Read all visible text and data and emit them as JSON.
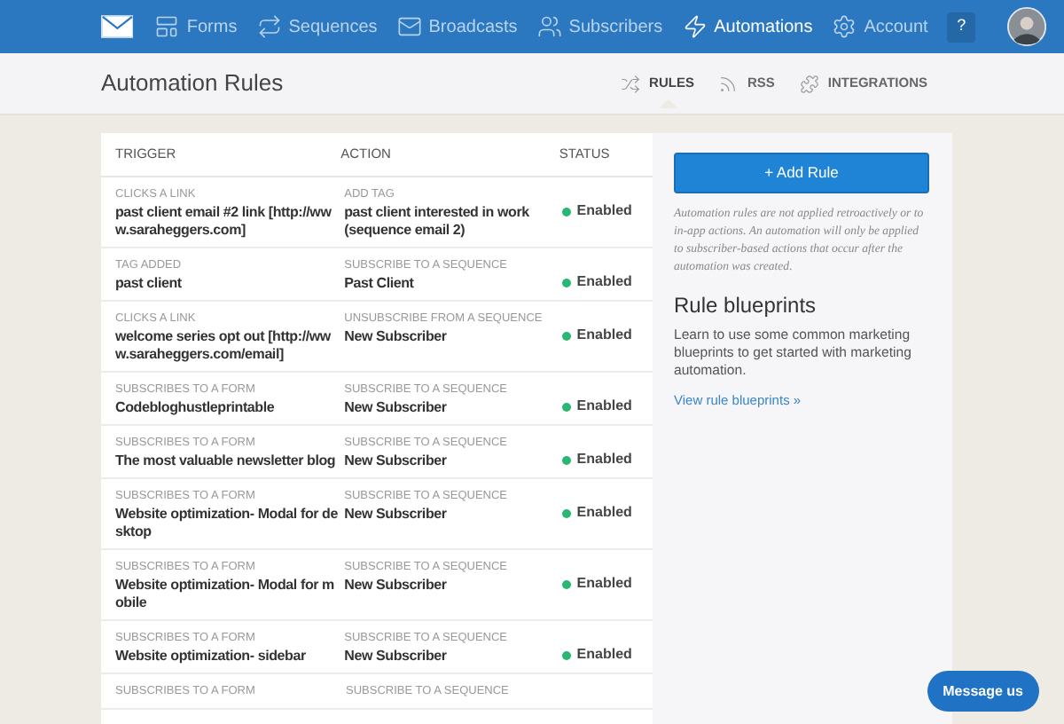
{
  "nav": {
    "items": [
      {
        "label": "Forms",
        "selected": false
      },
      {
        "label": "Sequences",
        "selected": false
      },
      {
        "label": "Broadcasts",
        "selected": false
      },
      {
        "label": "Subscribers",
        "selected": false
      },
      {
        "label": "Automations",
        "selected": true
      },
      {
        "label": "Account",
        "selected": false
      }
    ],
    "help": "?"
  },
  "header": {
    "title": "Automation Rules",
    "tabs": [
      {
        "label": "RULES",
        "selected": true
      },
      {
        "label": "RSS",
        "selected": false
      },
      {
        "label": "INTEGRATIONS",
        "selected": false
      }
    ]
  },
  "table": {
    "columns": [
      "TRIGGER",
      "ACTION",
      "STATUS"
    ],
    "rows": [
      {
        "trigger_type": "CLICKS A LINK",
        "trigger": "past client email #2 link [http://www.saraheggers.com]",
        "action_type": "ADD TAG",
        "action": "past client interested in work (sequence email 2)",
        "status": "Enabled",
        "enabled": true
      },
      {
        "trigger_type": "TAG ADDED",
        "trigger": "past client",
        "action_type": "SUBSCRIBE TO A SEQUENCE",
        "action": "Past Client",
        "status": "Enabled",
        "enabled": true
      },
      {
        "trigger_type": "CLICKS A LINK",
        "trigger": "welcome series opt out [http://www.saraheggers.com/email]",
        "action_type": "UNSUBSCRIBE FROM A SEQUENCE",
        "action": "New Subscriber",
        "status": "Enabled",
        "enabled": true
      },
      {
        "trigger_type": "SUBSCRIBES TO A FORM",
        "trigger": "Codebloghustleprintable",
        "action_type": "SUBSCRIBE TO A SEQUENCE",
        "action": "New Subscriber",
        "status": "Enabled",
        "enabled": true
      },
      {
        "trigger_type": "SUBSCRIBES TO A FORM",
        "trigger": "The most valuable newsletter blog",
        "action_type": "SUBSCRIBE TO A SEQUENCE",
        "action": "New Subscriber",
        "status": "Enabled",
        "enabled": true
      },
      {
        "trigger_type": "SUBSCRIBES TO A FORM",
        "trigger": "Website optimization- Modal for desktop",
        "action_type": "SUBSCRIBE TO A SEQUENCE",
        "action": "New Subscriber",
        "status": "Enabled",
        "enabled": true
      },
      {
        "trigger_type": "SUBSCRIBES TO A FORM",
        "trigger": "Website optimization- Modal for mobile",
        "action_type": "SUBSCRIBE TO A SEQUENCE",
        "action": "New Subscriber",
        "status": "Enabled",
        "enabled": true
      },
      {
        "trigger_type": "SUBSCRIBES TO A FORM",
        "trigger": "Website optimization- sidebar",
        "action_type": "SUBSCRIBE TO A SEQUENCE",
        "action": "New Subscriber",
        "status": "Enabled",
        "enabled": true
      },
      {
        "trigger_type": "SUBSCRIBES TO A FORM",
        "action_type": "SUBSCRIBE TO A SEQUENCE"
      }
    ]
  },
  "sidebar": {
    "add_button": "+ Add Rule",
    "note": "Automation rules are not applied retroactively or to in-app actions. An automation will only be applied to subscriber-based actions that occur after the automation was created.",
    "heading": "Rule blueprints",
    "text": "Learn to use some common marketing blueprints to get started with marketing automation.",
    "link": "View rule blueprints »"
  },
  "chat_button": "Message us"
}
